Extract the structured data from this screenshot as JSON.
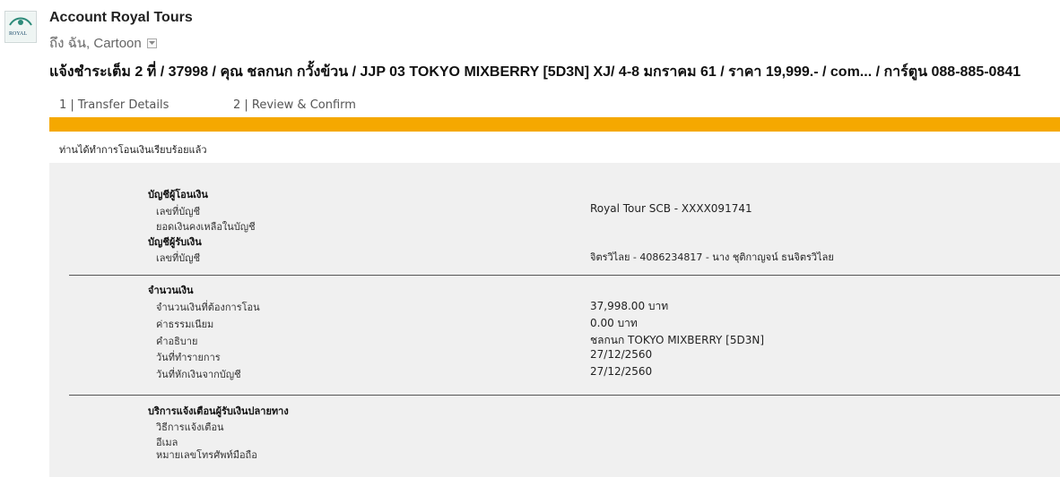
{
  "header": {
    "sender": "Account Royal Tours",
    "to": "ถึง ฉัน, Cartoon",
    "avatar_text": "ROYAL",
    "subject": "แจ้งชำระเต็ม  2 ที่ / 37998 / คุณ ชลกนก กวั้งข้วน / JJP 03 TOKYO MIXBERRY [5D3N] XJ/ 4-8 มกราคม 61 /  ราคา 19,999.- / com... / การ์ตูน 088-885-0841"
  },
  "steps": {
    "step1": "1 | Transfer Details",
    "step2": "2 | Review & Confirm"
  },
  "colors": {
    "progress": "#f5a800",
    "panel": "#f0f0f0"
  },
  "confirmation": "ท่านได้ทำการโอนเงินเรียบร้อยแล้ว",
  "from_account": {
    "title": "บัญชีผู้โอนเงิน",
    "account_label": "เลขที่บัญชี",
    "account_value": "Royal Tour SCB - XXXX091741",
    "balance_label": "ยอดเงินคงเหลือในบัญชี"
  },
  "to_account": {
    "title": "บัญชีผู้รับเงิน",
    "account_label": "เลขที่บัญชี",
    "account_value": "จิตรวิไลย - 4086234817 - นาง ชุติกาญจน์ ธนจิตรวิไลย"
  },
  "amount": {
    "title": "จำนวนเงิน",
    "transfer_label": "จำนวนเงินที่ต้องการโอน",
    "transfer_value": "37,998.00 บาท",
    "fee_label": "ค่าธรรมเนียม",
    "fee_value": "0.00  บาท",
    "desc_label": "คำอธิบาย",
    "desc_value": "ชลกนก TOKYO MIXBERRY [5D3N]",
    "txn_date_label": "วันที่ทำรายการ",
    "txn_date_value": "27/12/2560",
    "debit_date_label": "วันที่หักเงินจากบัญชี",
    "debit_date_value": "27/12/2560"
  },
  "notify": {
    "title": "บริการแจ้งเตือนผู้รับเงินปลายทาง",
    "method_label": "วิธีการแจ้งเตือน",
    "email_label": "อีเมล",
    "phone_label": "หมายเลขโทรศัพท์มือถือ"
  }
}
